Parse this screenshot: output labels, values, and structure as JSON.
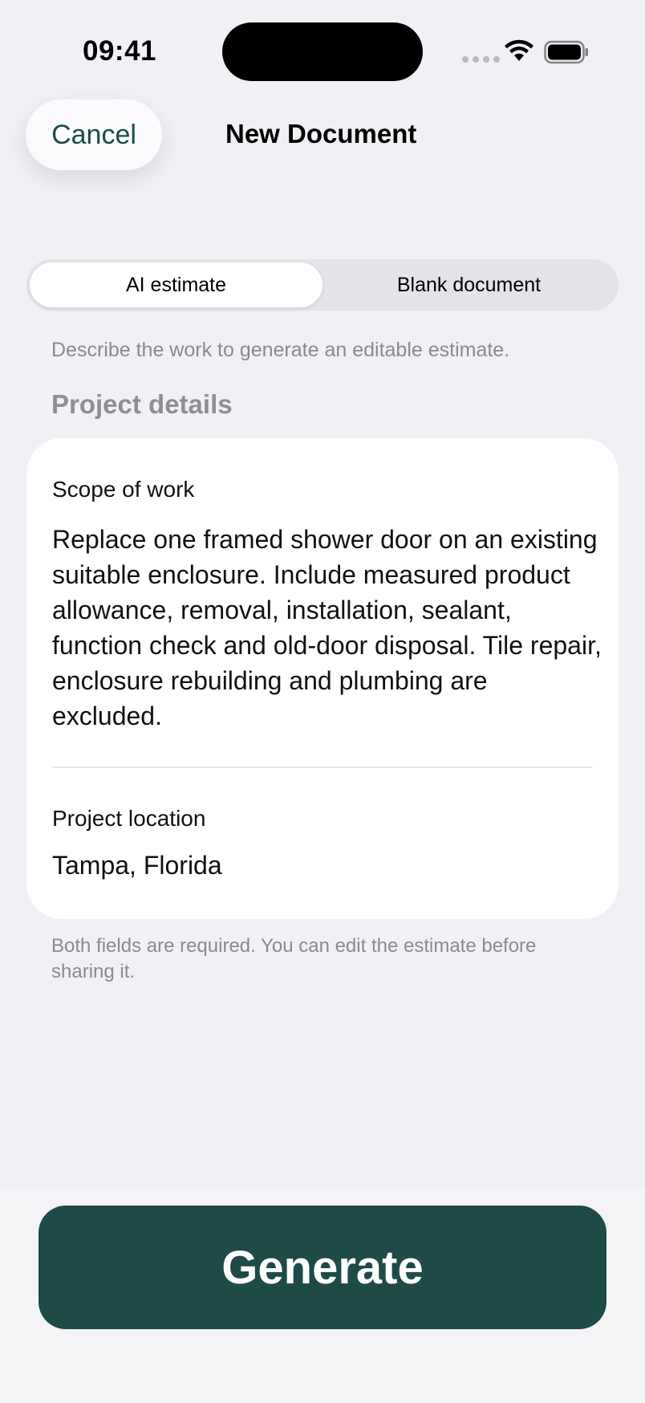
{
  "status": {
    "time": "09:41",
    "icons": [
      "signal-dots-icon",
      "wifi-icon",
      "battery-icon"
    ]
  },
  "nav": {
    "cancel_label": "Cancel",
    "title": "New Document"
  },
  "segmented": {
    "options": [
      "AI estimate",
      "Blank document"
    ],
    "selected": "AI estimate"
  },
  "helper_text": "Describe the work to generate an editable estimate.",
  "section_title": "Project details",
  "form": {
    "scope": {
      "label": "Scope of work",
      "value": "Replace one framed shower door on an existing suitable enclosure. Include measured product allowance, removal, installation, sealant, function check and old-door disposal. Tile repair, enclosure rebuilding and plumbing are excluded."
    },
    "location": {
      "label": "Project location",
      "value": "Tampa, Florida"
    }
  },
  "footnote": "Both fields are required. You can edit the estimate before sharing it.",
  "generate_label": "Generate",
  "colors": {
    "accent": "#1e4a48",
    "background": "#f1f0f5",
    "secondary_text": "#8a8a8f"
  }
}
